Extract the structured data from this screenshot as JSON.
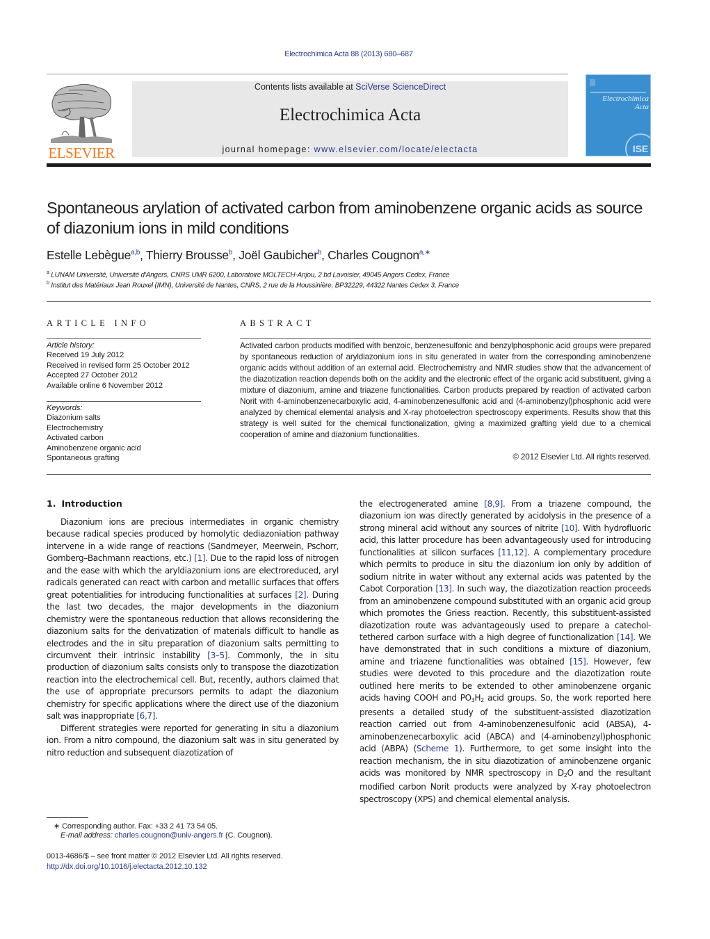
{
  "header": {
    "citation": "Electrochimica Acta 88 (2013) 680–687",
    "contents_prefix": "Contents lists available at ",
    "contents_link": "SciVerse ScienceDirect",
    "journal_title": "Electrochimica Acta",
    "homepage_prefix": "journal homepage: ",
    "homepage_link": "www.elsevier.com/locate/electacta",
    "publisher_logo_text": "ELSEVIER",
    "cover": {
      "title_line1": "Electrochimica",
      "title_line2": "Acta",
      "badge": "ISE"
    },
    "colors": {
      "link": "#2b3a8c",
      "elsevier_orange": "#f07a1e",
      "masthead_gray": "#e8e8e8",
      "cover_blue": "#3a8fd0"
    }
  },
  "article": {
    "title": "Spontaneous arylation of activated carbon from aminobenzene organic acids as source of diazonium ions in mild conditions",
    "authors": [
      {
        "name": "Estelle Lebègue",
        "sup": "a,b",
        "sep": ", "
      },
      {
        "name": "Thierry Brousse",
        "sup": "b",
        "sep": ", "
      },
      {
        "name": "Joël Gaubicher",
        "sup": "b",
        "sep": ", "
      },
      {
        "name": "Charles Cougnon",
        "sup": "a,∗",
        "sep": ""
      }
    ],
    "affiliations": [
      {
        "mark": "a",
        "text": "LUNAM Université, Université d'Angers, CNRS UMR 6200, Laboratoire MOLTECH-Anjou, 2 bd Lavoisier, 49045 Angers Cedex, France"
      },
      {
        "mark": "b",
        "text": "Institut des Matériaux Jean Rouxel (IMN), Université de Nantes, CNRS, 2 rue de la Houssinière, BP32229, 44322 Nantes Cedex 3, France"
      }
    ]
  },
  "article_info": {
    "label": "ARTICLE INFO",
    "history_label": "Article history:",
    "history": [
      "Received 19 July 2012",
      "Received in revised form 25 October 2012",
      "Accepted 27 October 2012",
      "Available online 6 November 2012"
    ],
    "keywords_label": "Keywords:",
    "keywords": [
      "Diazonium salts",
      "Electrochemistry",
      "Activated carbon",
      "Aminobenzene organic acid",
      "Spontaneous grafting"
    ]
  },
  "abstract": {
    "label": "ABSTRACT",
    "text": "Activated carbon products modified with benzoic, benzenesulfonic and benzylphosphonic acid groups were prepared by spontaneous reduction of aryldiazonium ions in situ generated in water from the corresponding aminobenzene organic acids without addition of an external acid. Electrochemistry and NMR studies show that the advancement of the diazotization reaction depends both on the acidity and the electronic effect of the organic acid substituent, giving a mixture of diazonium, amine and triazene functionalities. Carbon products prepared by reaction of activated carbon Norit with 4-aminobenzenecarboxylic acid, 4-aminobenzenesulfonic acid and (4-aminobenzyl)phosphonic acid were analyzed by chemical elemental analysis and X-ray photoelectron spectroscopy experiments. Results show that this strategy is well suited for the chemical functionalization, giving a maximized grafting yield due to a chemical cooperation of amine and diazonium functionalities.",
    "copyright": "© 2012 Elsevier Ltd. All rights reserved."
  },
  "body": {
    "section_number": "1.",
    "section_title": "Introduction",
    "left": {
      "p1": [
        {
          "t": "Diazonium ions are precious intermediates in organic chemistry because radical species produced by homolytic dediazoniation pathway intervene in a wide range of reactions (Sandmeyer, Meerwein, Pschorr, Gomberg–Bachmann reactions, etc.) "
        },
        {
          "r": "[1]"
        },
        {
          "t": ". Due to the rapid loss of nitrogen and the ease with which the aryldiazonium ions are electroreduced, aryl radicals generated can react with carbon and metallic surfaces that offers great potentialities for introducing functionalities at surfaces "
        },
        {
          "r": "[2]"
        },
        {
          "t": ". During the last two decades, the major developments in the diazonium chemistry were the spontaneous reduction that allows reconsidering the diazonium salts for the derivatization of materials difficult to handle as electrodes and the in situ preparation of diazonium salts permitting to circumvent their intrinsic instability "
        },
        {
          "r": "[3–5]"
        },
        {
          "t": ". Commonly, the in situ production of diazonium salts consists only to transpose the diazotization reaction into the electrochemical cell. But, recently, authors claimed that the use of appropriate precursors permits to adapt the diazonium chemistry for specific applications where the direct use of the diazonium salt was inappropriate "
        },
        {
          "r": "[6,7]"
        },
        {
          "t": "."
        }
      ],
      "p2": [
        {
          "t": "Different strategies were reported for generating in situ a diazonium ion. From a nitro compound, the diazonium salt was in situ generated by nitro reduction and subsequent diazotization of"
        }
      ]
    },
    "right": {
      "p1": [
        {
          "t": "the electrogenerated amine "
        },
        {
          "r": "[8,9]"
        },
        {
          "t": ". From a triazene compound, the diazonium ion was directly generated by acidolysis in the presence of a strong mineral acid without any sources of nitrite "
        },
        {
          "r": "[10]"
        },
        {
          "t": ". With hydrofluoric acid, this latter procedure has been advantageously used for introducing functionalities at silicon surfaces "
        },
        {
          "r": "[11,12]"
        },
        {
          "t": ". A complementary procedure which permits to produce in situ the diazonium ion only by addition of sodium nitrite in water without any external acids was patented by the Cabot Corporation "
        },
        {
          "r": "[13]"
        },
        {
          "t": ". In such way, the diazotization reaction proceeds from an aminobenzene compound substituted with an organic acid group which promotes the Griess reaction. Recently, this substituent-assisted diazotization route was advantageously used to prepare a catechol-tethered carbon surface with a high degree of functionalization "
        },
        {
          "r": "[14]"
        },
        {
          "t": ". We have demonstrated that in such conditions a mixture of diazonium, amine and triazene functionalities was obtained "
        },
        {
          "r": "[15]"
        },
        {
          "t": ". However, few studies were devoted to this procedure and the diazotization route outlined here merits to be extended to other aminobenzene organic acids having COOH and PO"
        },
        {
          "sub": "3"
        },
        {
          "t": "H"
        },
        {
          "sub": "2"
        },
        {
          "t": " acid groups. So, the work reported here presents a detailed study of the substituent-assisted diazotization reaction carried out from 4-aminobenzenesulfonic acid (ABSA), 4-aminobenzenecarboxylic acid (ABCA) and (4-aminobenzyl)phosphonic acid (ABPA) ("
        },
        {
          "r": "Scheme 1"
        },
        {
          "t": "). Furthermore, to get some insight into the reaction mechanism, the in situ diazotization of aminobenzene organic acids was monitored by NMR spectroscopy in D"
        },
        {
          "sub": "2"
        },
        {
          "t": "O and the resultant modified carbon Norit products were analyzed by X-ray photoelectron spectroscopy (XPS) and chemical elemental analysis."
        }
      ]
    }
  },
  "footnotes": {
    "corresponding": "∗  Corresponding author. Fax: +33 2 41 73 54 05.",
    "email_label": "E-mail address: ",
    "email": "charles.cougnon@univ-angers.fr",
    "email_suffix": " (C. Cougnon).",
    "issn": "0013-4686/$ – see front matter © 2012 Elsevier Ltd. All rights reserved.",
    "doi": "http://dx.doi.org/10.1016/j.electacta.2012.10.132"
  }
}
